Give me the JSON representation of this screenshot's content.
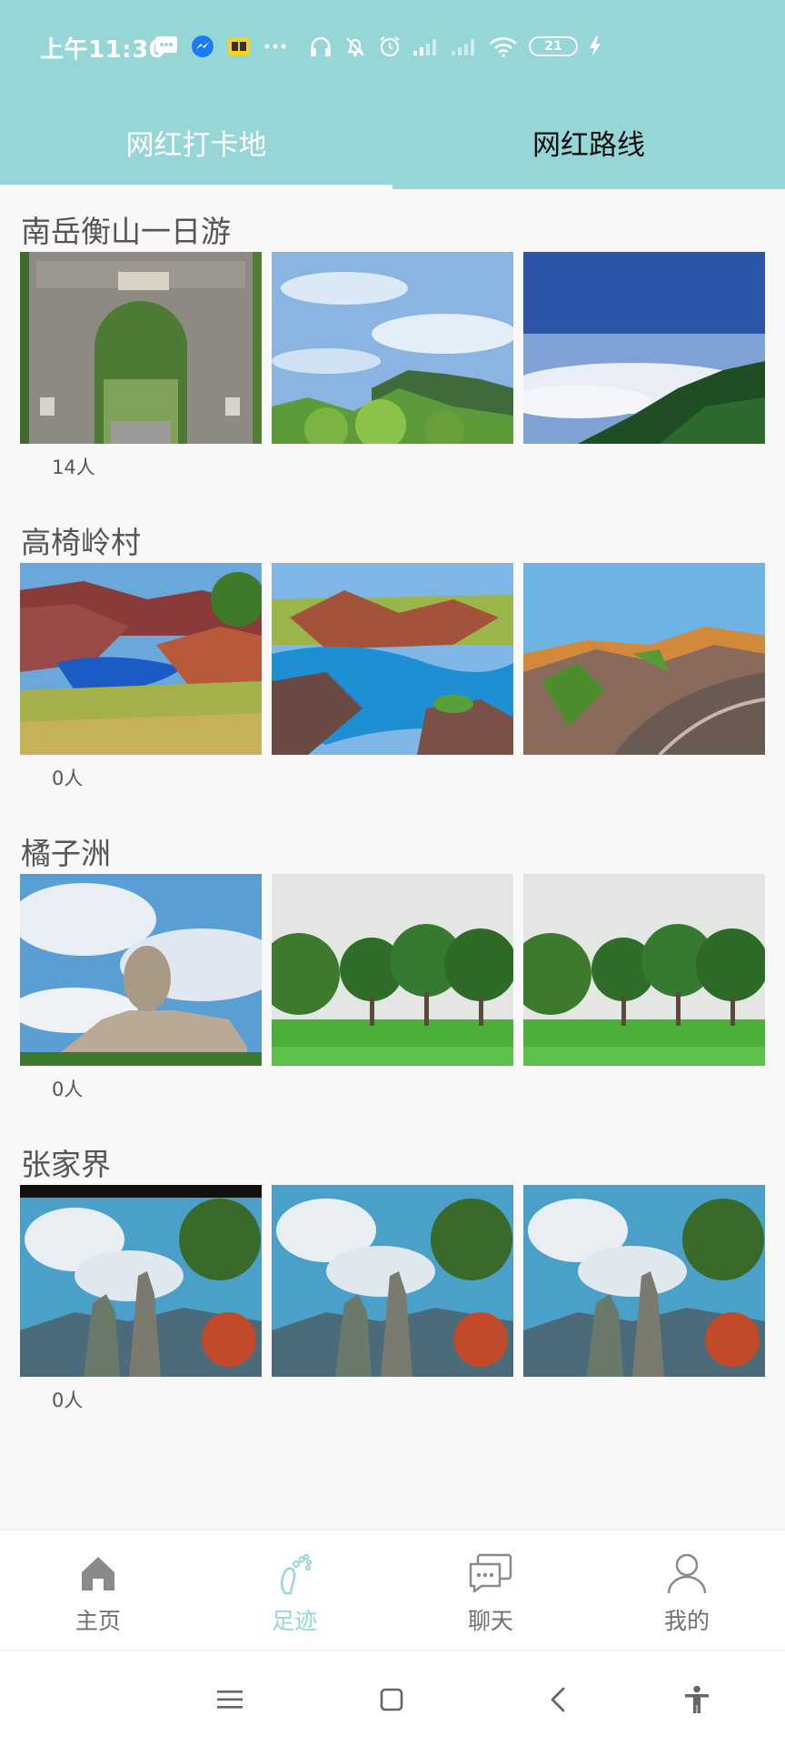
{
  "status_bar": {
    "time": "上午11:30",
    "battery": "21",
    "icons": [
      "message-icon",
      "messenger-icon",
      "sim-card-icon",
      "more-dots-icon",
      "headphones-icon",
      "mute-bell-icon",
      "alarm-icon",
      "signal-icon",
      "signal-weak-icon",
      "wifi-icon",
      "battery-icon",
      "charging-icon"
    ]
  },
  "tabs": [
    {
      "label": "网红打卡地",
      "active": true
    },
    {
      "label": "网红路线",
      "active": false
    }
  ],
  "spots": [
    {
      "title": "南岳衡山一日游",
      "count": "14人",
      "photos": [
        "stone-arch-gate-photo",
        "mountain-peak-sky-photo",
        "sea-of-clouds-photo"
      ]
    },
    {
      "title": "高椅岭村",
      "count": "0人",
      "photos": [
        "red-rock-lake-photo",
        "red-rock-lake-photo",
        "red-rock-ridge-photo"
      ]
    },
    {
      "title": "橘子洲",
      "count": "0人",
      "photos": [
        "mao-statue-photo",
        "green-lawn-trees-photo",
        "green-lawn-trees-photo"
      ]
    },
    {
      "title": "张家界",
      "count": "0人",
      "photos": [
        "zhangjiajie-peaks-photo",
        "zhangjiajie-peaks-photo",
        "zhangjiajie-peaks-photo"
      ]
    }
  ],
  "bottom_nav": [
    {
      "label": "主页",
      "icon": "home-icon",
      "active": false
    },
    {
      "label": "足迹",
      "icon": "footprint-icon",
      "active": true
    },
    {
      "label": "聊天",
      "icon": "chat-icon",
      "active": false
    },
    {
      "label": "我的",
      "icon": "person-icon",
      "active": false
    }
  ],
  "system_nav": [
    "menu-icon",
    "home-square-icon",
    "back-icon",
    "accessibility-icon"
  ],
  "colors": {
    "accent": "#96d6d6",
    "background": "#f8f8f8",
    "nav_inactive": "#707070",
    "title_text": "#555555"
  }
}
